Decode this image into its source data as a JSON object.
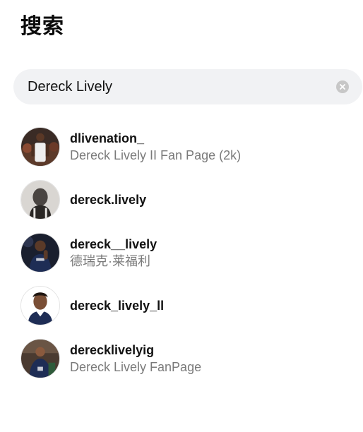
{
  "header": {
    "title": "搜索"
  },
  "search": {
    "value": "Dereck Lively",
    "placeholder": ""
  },
  "results": [
    {
      "username": "dlivenation_",
      "subtitle": "Dereck Lively II Fan Page (2k)"
    },
    {
      "username": "dereck.lively",
      "subtitle": ""
    },
    {
      "username": "dereck__lively",
      "subtitle": "德瑞克·莱福利"
    },
    {
      "username": "dereck_lively_ll",
      "subtitle": ""
    },
    {
      "username": "derecklivelyig",
      "subtitle": "Dereck Lively FanPage"
    }
  ],
  "colors": {
    "search_bg": "#f1f2f4",
    "secondary_text": "#7a7a7a",
    "clear_icon_bg": "#c7c7c7"
  }
}
